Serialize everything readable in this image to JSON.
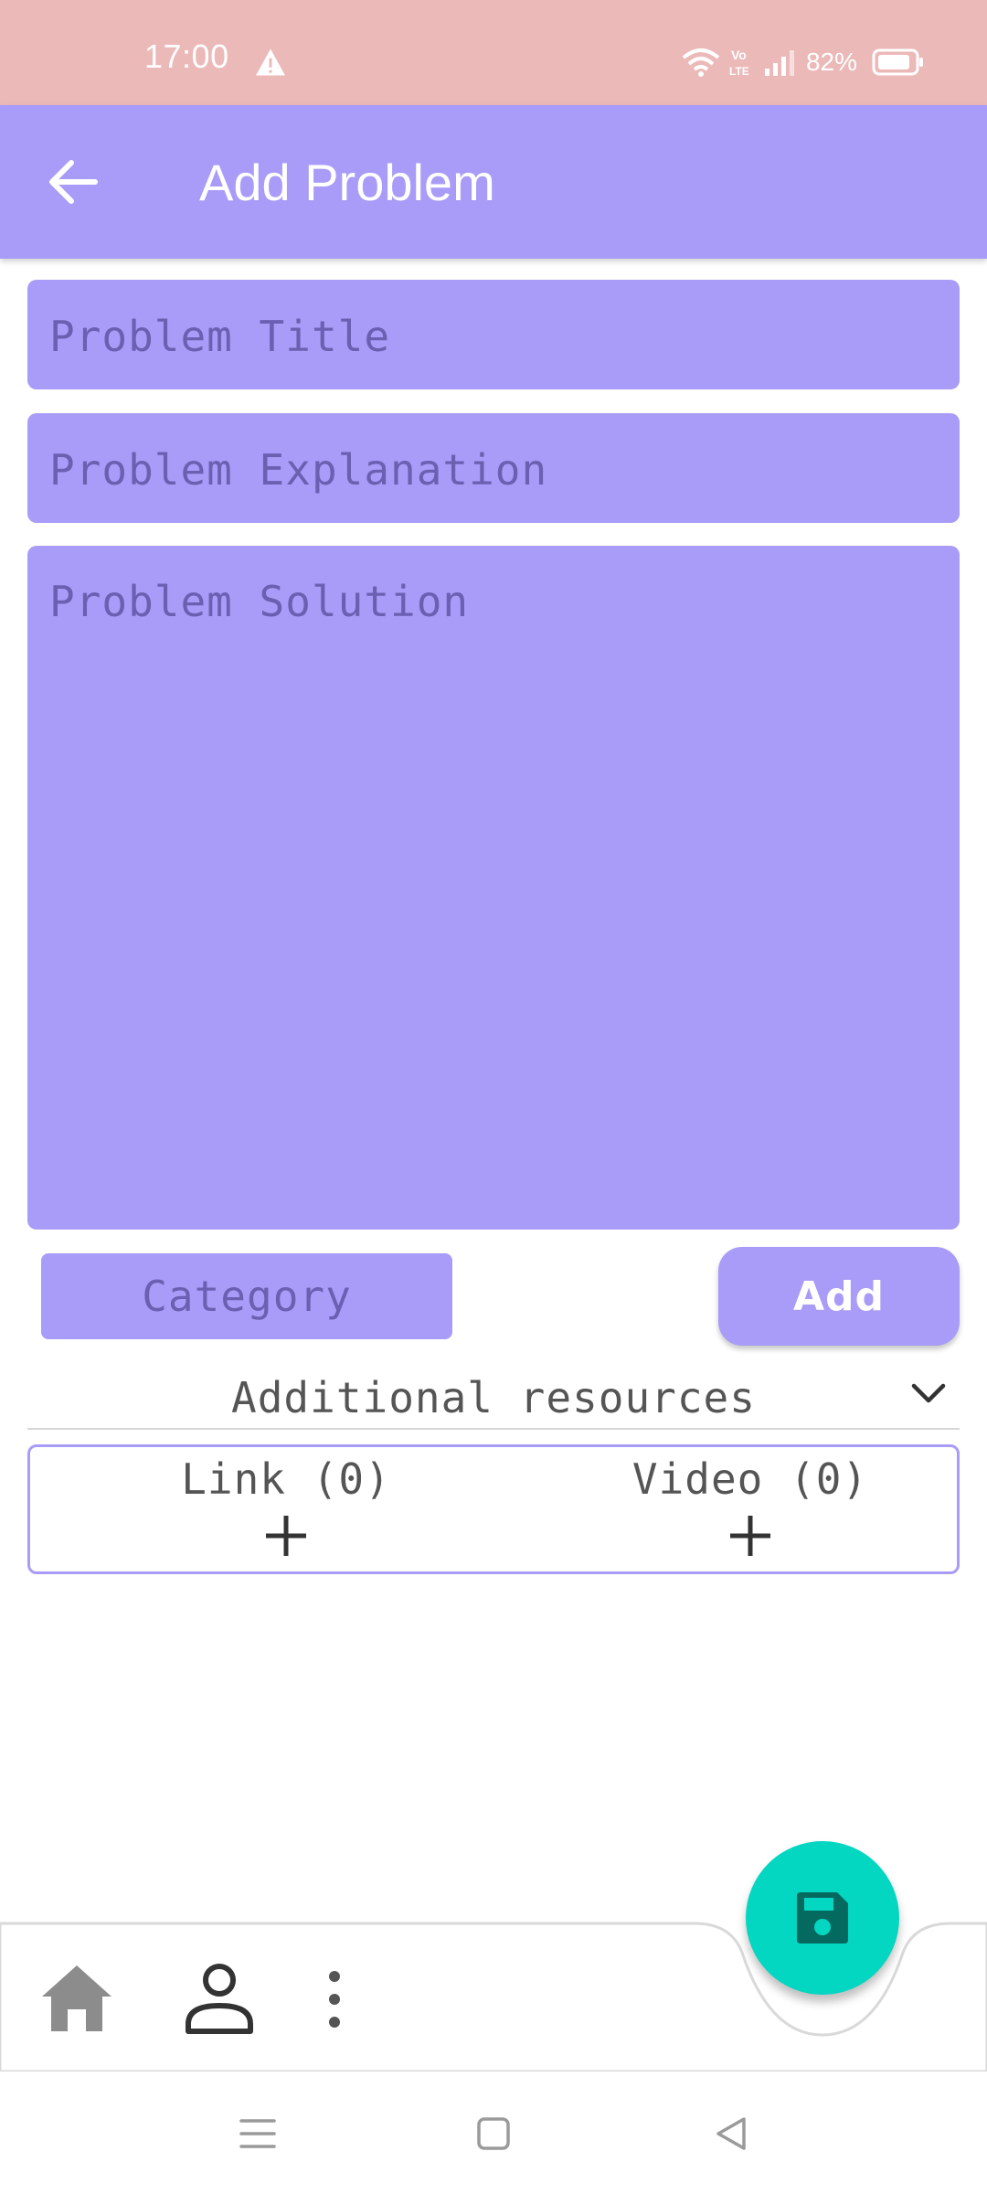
{
  "status_bar": {
    "time": "17:00",
    "battery_percent": "82%",
    "network_badge_top": "Vo",
    "network_badge_bottom": "LTE"
  },
  "app_bar": {
    "title": "Add Problem",
    "back_icon": "arrow-left-icon"
  },
  "form": {
    "title_placeholder": "Problem Title",
    "explanation_placeholder": "Problem Explanation",
    "solution_placeholder": "Problem Solution",
    "category_label": "Category",
    "add_label": "Add"
  },
  "resources": {
    "header": "Additional resources",
    "link_label": "Link (0)",
    "video_label": "Video (0)"
  },
  "bottom_nav": {
    "items": [
      {
        "icon": "home-icon"
      },
      {
        "icon": "person-icon"
      },
      {
        "icon": "more-vertical-icon"
      }
    ],
    "fab_icon": "save-icon"
  },
  "colors": {
    "status_bar": "#ebb9b8",
    "primary": "#a89cf8",
    "placeholder_text": "#6a5fb1",
    "fab": "#03d6c1",
    "fab_icon": "#046a60"
  }
}
